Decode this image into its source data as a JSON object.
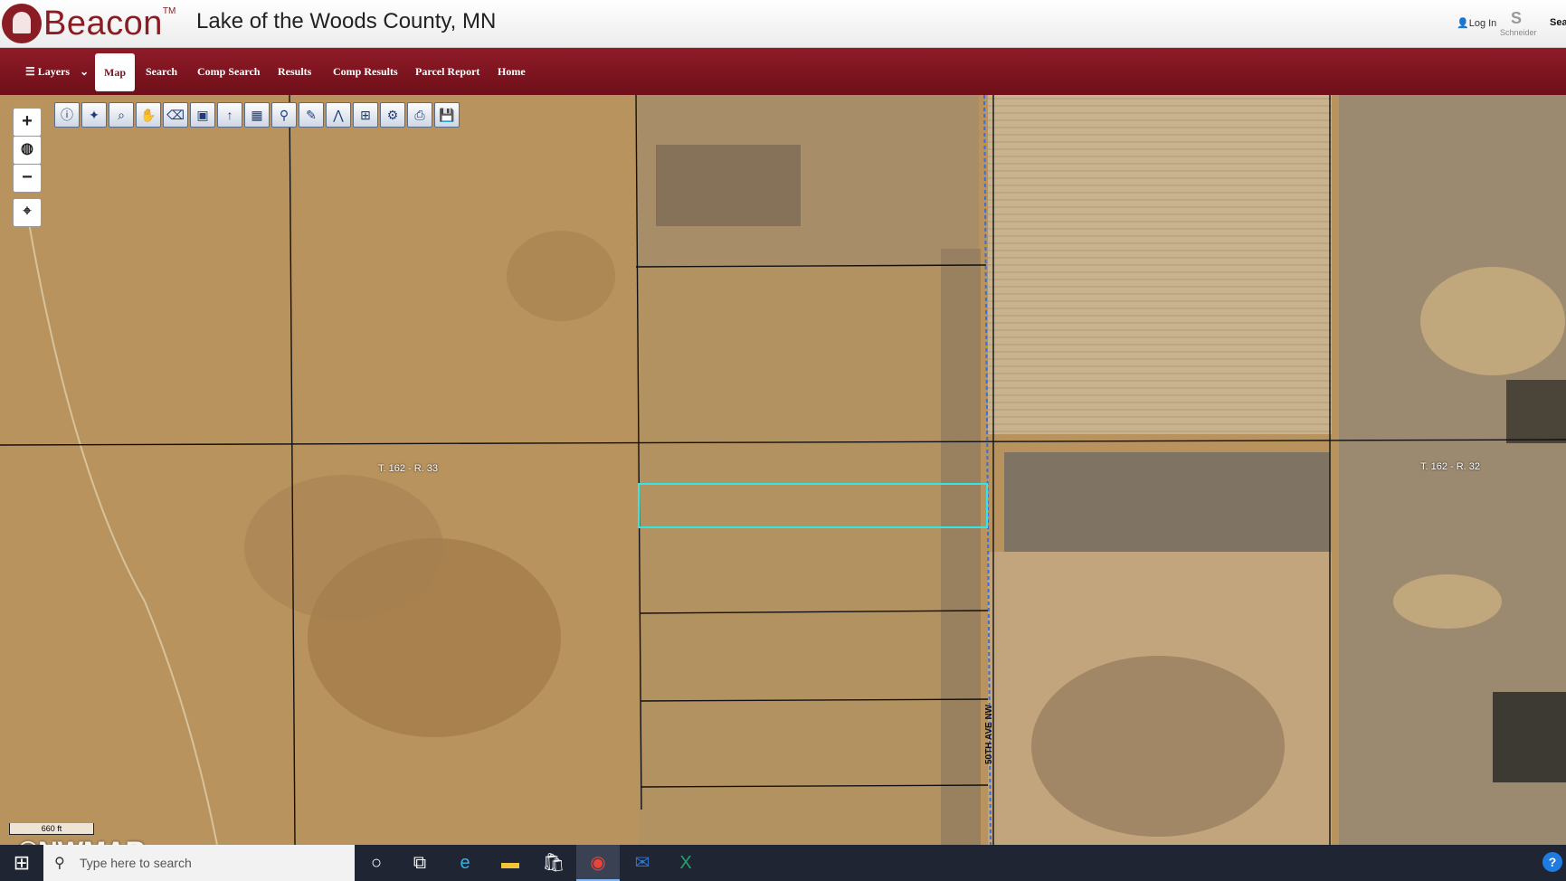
{
  "header": {
    "brand": "Beacon",
    "trademark": "TM",
    "title": "Lake of the Woods County, MN",
    "login": "Log In",
    "partner": "Schneider",
    "search_label": "Sea"
  },
  "nav": {
    "layers": "Layers",
    "items": [
      "Map",
      "Search",
      "Comp Search",
      "Results",
      "Comp Results",
      "Parcel Report",
      "Home"
    ],
    "active": "Map"
  },
  "map_controls": {
    "zoom_in": "+",
    "globe": "◍",
    "zoom_out": "−",
    "locate": "⌖"
  },
  "toolbar_icons": [
    "info-icon",
    "identify-icon",
    "zoom-box-icon",
    "pan-icon",
    "eraser-icon",
    "select-icon",
    "marker-icon",
    "buffer-icon",
    "search-icon",
    "draw-icon",
    "measure-icon",
    "extent-icon",
    "print-icon",
    "export-icon",
    "save-icon"
  ],
  "map": {
    "scale": "660 ft",
    "labels": {
      "tr_left": "T. 162 - R. 33",
      "tr_right": "T. 162 - R. 32",
      "road": "50TH AVE NW"
    },
    "highlight_color": "#33e6e6",
    "watermark": "©NWMAR"
  },
  "taskbar": {
    "search_placeholder": "Type here to search",
    "apps": [
      "cortana-icon",
      "task-view-icon",
      "edge-icon",
      "file-explorer-icon",
      "store-icon",
      "chrome-icon",
      "outlook-icon",
      "excel-icon"
    ],
    "help": "?"
  }
}
